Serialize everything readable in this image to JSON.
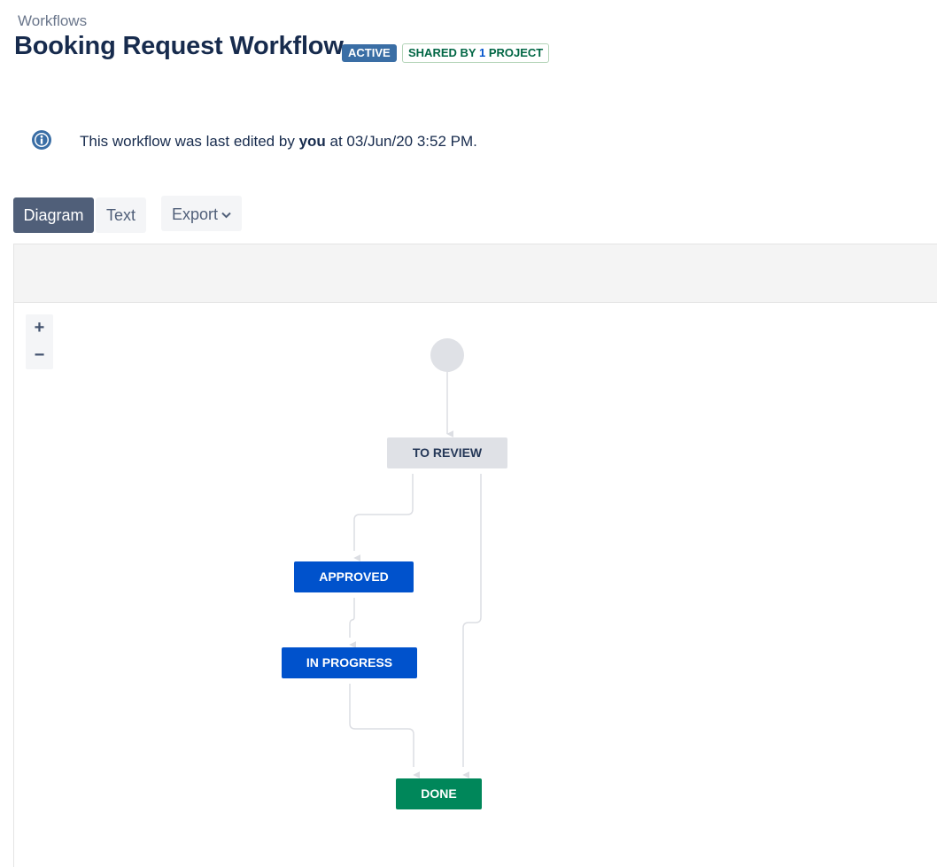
{
  "breadcrumb": "Workflows",
  "title": "Booking Request Workflow",
  "badges": {
    "active": "ACTIVE",
    "shared_prefix": "SHARED BY",
    "shared_count": "1",
    "shared_suffix": "PROJECT"
  },
  "info": {
    "prefix": "This workflow was last edited by",
    "user": "you",
    "suffix": "at 03/Jun/20 3:52 PM."
  },
  "tabs": {
    "diagram": "Diagram",
    "text": "Text",
    "export": "Export"
  },
  "zoom": {
    "in": "+",
    "out": "−"
  },
  "statuses": {
    "to_review": "TO REVIEW",
    "approved": "APPROVED",
    "in_progress": "IN PROGRESS",
    "done": "DONE"
  },
  "colors": {
    "primary": "#0052cc",
    "done": "#00875a",
    "todo": "#dfe1e6",
    "active_badge": "#3a6ea5",
    "selected_tab": "#505f79"
  }
}
